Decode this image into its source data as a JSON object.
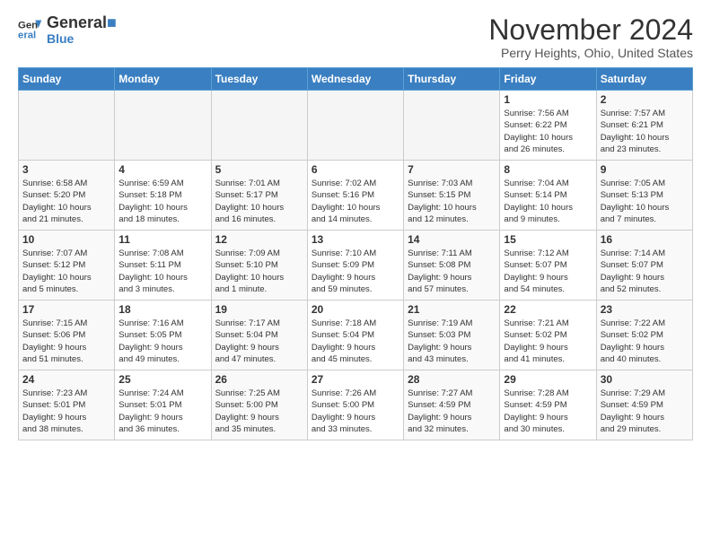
{
  "header": {
    "logo_line1": "General",
    "logo_line2": "Blue",
    "month": "November 2024",
    "location": "Perry Heights, Ohio, United States"
  },
  "weekdays": [
    "Sunday",
    "Monday",
    "Tuesday",
    "Wednesday",
    "Thursday",
    "Friday",
    "Saturday"
  ],
  "weeks": [
    [
      {
        "day": "",
        "info": "",
        "empty": true
      },
      {
        "day": "",
        "info": "",
        "empty": true
      },
      {
        "day": "",
        "info": "",
        "empty": true
      },
      {
        "day": "",
        "info": "",
        "empty": true
      },
      {
        "day": "",
        "info": "",
        "empty": true
      },
      {
        "day": "1",
        "info": "Sunrise: 7:56 AM\nSunset: 6:22 PM\nDaylight: 10 hours\nand 26 minutes.",
        "empty": false
      },
      {
        "day": "2",
        "info": "Sunrise: 7:57 AM\nSunset: 6:21 PM\nDaylight: 10 hours\nand 23 minutes.",
        "empty": false
      }
    ],
    [
      {
        "day": "3",
        "info": "Sunrise: 6:58 AM\nSunset: 5:20 PM\nDaylight: 10 hours\nand 21 minutes.",
        "empty": false
      },
      {
        "day": "4",
        "info": "Sunrise: 6:59 AM\nSunset: 5:18 PM\nDaylight: 10 hours\nand 18 minutes.",
        "empty": false
      },
      {
        "day": "5",
        "info": "Sunrise: 7:01 AM\nSunset: 5:17 PM\nDaylight: 10 hours\nand 16 minutes.",
        "empty": false
      },
      {
        "day": "6",
        "info": "Sunrise: 7:02 AM\nSunset: 5:16 PM\nDaylight: 10 hours\nand 14 minutes.",
        "empty": false
      },
      {
        "day": "7",
        "info": "Sunrise: 7:03 AM\nSunset: 5:15 PM\nDaylight: 10 hours\nand 12 minutes.",
        "empty": false
      },
      {
        "day": "8",
        "info": "Sunrise: 7:04 AM\nSunset: 5:14 PM\nDaylight: 10 hours\nand 9 minutes.",
        "empty": false
      },
      {
        "day": "9",
        "info": "Sunrise: 7:05 AM\nSunset: 5:13 PM\nDaylight: 10 hours\nand 7 minutes.",
        "empty": false
      }
    ],
    [
      {
        "day": "10",
        "info": "Sunrise: 7:07 AM\nSunset: 5:12 PM\nDaylight: 10 hours\nand 5 minutes.",
        "empty": false
      },
      {
        "day": "11",
        "info": "Sunrise: 7:08 AM\nSunset: 5:11 PM\nDaylight: 10 hours\nand 3 minutes.",
        "empty": false
      },
      {
        "day": "12",
        "info": "Sunrise: 7:09 AM\nSunset: 5:10 PM\nDaylight: 10 hours\nand 1 minute.",
        "empty": false
      },
      {
        "day": "13",
        "info": "Sunrise: 7:10 AM\nSunset: 5:09 PM\nDaylight: 9 hours\nand 59 minutes.",
        "empty": false
      },
      {
        "day": "14",
        "info": "Sunrise: 7:11 AM\nSunset: 5:08 PM\nDaylight: 9 hours\nand 57 minutes.",
        "empty": false
      },
      {
        "day": "15",
        "info": "Sunrise: 7:12 AM\nSunset: 5:07 PM\nDaylight: 9 hours\nand 54 minutes.",
        "empty": false
      },
      {
        "day": "16",
        "info": "Sunrise: 7:14 AM\nSunset: 5:07 PM\nDaylight: 9 hours\nand 52 minutes.",
        "empty": false
      }
    ],
    [
      {
        "day": "17",
        "info": "Sunrise: 7:15 AM\nSunset: 5:06 PM\nDaylight: 9 hours\nand 51 minutes.",
        "empty": false
      },
      {
        "day": "18",
        "info": "Sunrise: 7:16 AM\nSunset: 5:05 PM\nDaylight: 9 hours\nand 49 minutes.",
        "empty": false
      },
      {
        "day": "19",
        "info": "Sunrise: 7:17 AM\nSunset: 5:04 PM\nDaylight: 9 hours\nand 47 minutes.",
        "empty": false
      },
      {
        "day": "20",
        "info": "Sunrise: 7:18 AM\nSunset: 5:04 PM\nDaylight: 9 hours\nand 45 minutes.",
        "empty": false
      },
      {
        "day": "21",
        "info": "Sunrise: 7:19 AM\nSunset: 5:03 PM\nDaylight: 9 hours\nand 43 minutes.",
        "empty": false
      },
      {
        "day": "22",
        "info": "Sunrise: 7:21 AM\nSunset: 5:02 PM\nDaylight: 9 hours\nand 41 minutes.",
        "empty": false
      },
      {
        "day": "23",
        "info": "Sunrise: 7:22 AM\nSunset: 5:02 PM\nDaylight: 9 hours\nand 40 minutes.",
        "empty": false
      }
    ],
    [
      {
        "day": "24",
        "info": "Sunrise: 7:23 AM\nSunset: 5:01 PM\nDaylight: 9 hours\nand 38 minutes.",
        "empty": false
      },
      {
        "day": "25",
        "info": "Sunrise: 7:24 AM\nSunset: 5:01 PM\nDaylight: 9 hours\nand 36 minutes.",
        "empty": false
      },
      {
        "day": "26",
        "info": "Sunrise: 7:25 AM\nSunset: 5:00 PM\nDaylight: 9 hours\nand 35 minutes.",
        "empty": false
      },
      {
        "day": "27",
        "info": "Sunrise: 7:26 AM\nSunset: 5:00 PM\nDaylight: 9 hours\nand 33 minutes.",
        "empty": false
      },
      {
        "day": "28",
        "info": "Sunrise: 7:27 AM\nSunset: 4:59 PM\nDaylight: 9 hours\nand 32 minutes.",
        "empty": false
      },
      {
        "day": "29",
        "info": "Sunrise: 7:28 AM\nSunset: 4:59 PM\nDaylight: 9 hours\nand 30 minutes.",
        "empty": false
      },
      {
        "day": "30",
        "info": "Sunrise: 7:29 AM\nSunset: 4:59 PM\nDaylight: 9 hours\nand 29 minutes.",
        "empty": false
      }
    ]
  ]
}
